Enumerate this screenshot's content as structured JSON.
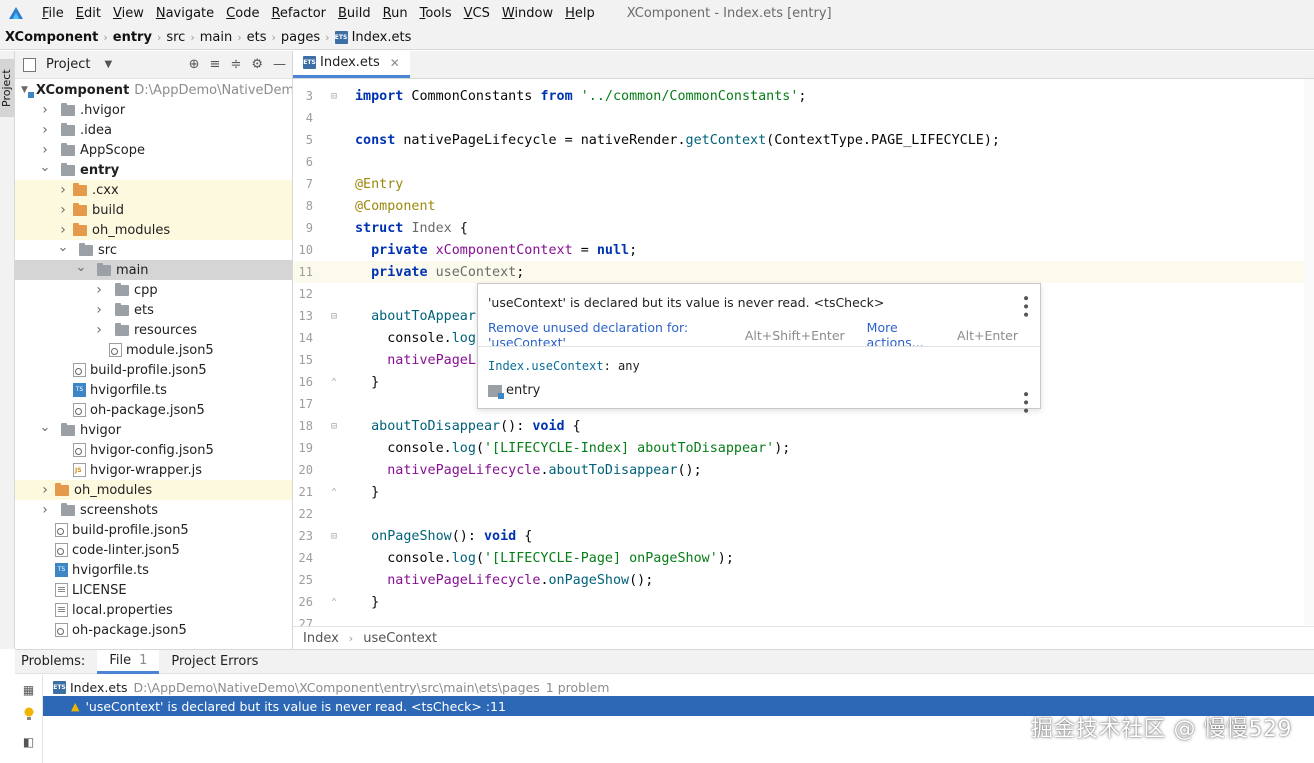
{
  "menubar": {
    "items": [
      "File",
      "Edit",
      "View",
      "Navigate",
      "Code",
      "Refactor",
      "Build",
      "Run",
      "Tools",
      "VCS",
      "Window",
      "Help"
    ],
    "window_title": "XComponent - Index.ets [entry]"
  },
  "breadcrumb": {
    "items": [
      "XComponent",
      "entry",
      "src",
      "main",
      "ets",
      "pages",
      "Index.ets"
    ]
  },
  "stripe": {
    "project_label": "Project"
  },
  "project_panel": {
    "title": "Project",
    "root": {
      "name": "XComponent",
      "path": "D:\\AppDemo\\NativeDemo"
    },
    "tree": [
      {
        "label": ".hvigor",
        "depth": 1,
        "icon": "folder",
        "color": "gray",
        "arrow": "right"
      },
      {
        "label": ".idea",
        "depth": 1,
        "icon": "folder",
        "color": "gray",
        "arrow": "right"
      },
      {
        "label": "AppScope",
        "depth": 1,
        "icon": "folder",
        "color": "gray",
        "arrow": "right"
      },
      {
        "label": "entry",
        "depth": 1,
        "icon": "folder",
        "color": "gray",
        "arrow": "down",
        "bold": true
      },
      {
        "label": ".cxx",
        "depth": 2,
        "icon": "folder",
        "color": "orange",
        "arrow": "right",
        "highlight": "yellow"
      },
      {
        "label": "build",
        "depth": 2,
        "icon": "folder",
        "color": "orange",
        "arrow": "right",
        "highlight": "yellow"
      },
      {
        "label": "oh_modules",
        "depth": 2,
        "icon": "folder",
        "color": "orange",
        "arrow": "right",
        "highlight": "yellow"
      },
      {
        "label": "src",
        "depth": 2,
        "icon": "folder",
        "color": "gray",
        "arrow": "down"
      },
      {
        "label": "main",
        "depth": 3,
        "icon": "folder",
        "color": "gray",
        "arrow": "down",
        "highlight": "gray"
      },
      {
        "label": "cpp",
        "depth": 4,
        "icon": "folder",
        "color": "gray",
        "arrow": "right"
      },
      {
        "label": "ets",
        "depth": 4,
        "icon": "folder",
        "color": "gray",
        "arrow": "right"
      },
      {
        "label": "resources",
        "depth": 4,
        "icon": "folder",
        "color": "gray",
        "arrow": "right"
      },
      {
        "label": "module.json5",
        "depth": 4,
        "icon": "json",
        "arrow": "none"
      },
      {
        "label": "build-profile.json5",
        "depth": 2,
        "icon": "json",
        "arrow": "none"
      },
      {
        "label": "hvigorfile.ts",
        "depth": 2,
        "icon": "ts",
        "arrow": "none"
      },
      {
        "label": "oh-package.json5",
        "depth": 2,
        "icon": "json",
        "arrow": "none"
      },
      {
        "label": "hvigor",
        "depth": 1,
        "icon": "folder",
        "color": "gray",
        "arrow": "down"
      },
      {
        "label": "hvigor-config.json5",
        "depth": 2,
        "icon": "json",
        "arrow": "none"
      },
      {
        "label": "hvigor-wrapper.js",
        "depth": 2,
        "icon": "js",
        "arrow": "none"
      },
      {
        "label": "oh_modules",
        "depth": 1,
        "icon": "folder",
        "color": "orange",
        "arrow": "right",
        "highlight": "yellow"
      },
      {
        "label": "screenshots",
        "depth": 1,
        "icon": "folder",
        "color": "gray",
        "arrow": "right"
      },
      {
        "label": "build-profile.json5",
        "depth": 1,
        "icon": "json",
        "arrow": "none"
      },
      {
        "label": "code-linter.json5",
        "depth": 1,
        "icon": "json",
        "arrow": "none"
      },
      {
        "label": "hvigorfile.ts",
        "depth": 1,
        "icon": "ts",
        "arrow": "none"
      },
      {
        "label": "LICENSE",
        "depth": 1,
        "icon": "text",
        "arrow": "none"
      },
      {
        "label": "local.properties",
        "depth": 1,
        "icon": "text",
        "arrow": "none"
      },
      {
        "label": "oh-package.json5",
        "depth": 1,
        "icon": "json",
        "arrow": "none"
      }
    ]
  },
  "editor": {
    "tab_label": "Index.ets",
    "footer": {
      "scope": "Index",
      "member": "useContext"
    },
    "lines": [
      {
        "n": "3",
        "fold": "start",
        "tokens": [
          [
            "kw",
            "import"
          ],
          [
            "code",
            " CommonConstants "
          ],
          [
            "kw",
            "from"
          ],
          [
            "code",
            " "
          ],
          [
            "str",
            "'../common/CommonConstants'"
          ],
          [
            "code",
            ";"
          ]
        ]
      },
      {
        "n": "4",
        "tokens": []
      },
      {
        "n": "5",
        "tokens": [
          [
            "kw",
            "const"
          ],
          [
            "code",
            " nativePageLifecycle = nativeRender."
          ],
          [
            "fn",
            "getContext"
          ],
          [
            "code",
            "(ContextType."
          ],
          [
            "code",
            "PAGE_LIFECYCLE"
          ],
          [
            "code",
            ");"
          ]
        ]
      },
      {
        "n": "6",
        "tokens": []
      },
      {
        "n": "7",
        "tokens": [
          [
            "dec",
            "@Entry"
          ]
        ]
      },
      {
        "n": "8",
        "tokens": [
          [
            "dec",
            "@Component"
          ]
        ]
      },
      {
        "n": "9",
        "tokens": [
          [
            "kw",
            "struct"
          ],
          [
            "code",
            " "
          ],
          [
            "muted",
            "Index"
          ],
          [
            "code",
            " {"
          ]
        ]
      },
      {
        "n": "10",
        "tokens": [
          [
            "code",
            "  "
          ],
          [
            "kw",
            "private"
          ],
          [
            "code",
            " "
          ],
          [
            "purple",
            "xComponentContext"
          ],
          [
            "code",
            " = "
          ],
          [
            "kw",
            "null"
          ],
          [
            "code",
            ";"
          ]
        ]
      },
      {
        "n": "11",
        "current": true,
        "tokens": [
          [
            "code",
            "  "
          ],
          [
            "kw",
            "private"
          ],
          [
            "code",
            " "
          ],
          [
            "muted",
            "useContext"
          ],
          [
            "code",
            ";"
          ]
        ]
      },
      {
        "n": "12",
        "tokens": []
      },
      {
        "n": "13",
        "fold": "start",
        "tokens": [
          [
            "code",
            "  "
          ],
          [
            "fn",
            "aboutToAppear"
          ]
        ]
      },
      {
        "n": "14",
        "tokens": [
          [
            "code",
            "    console."
          ],
          [
            "fn",
            "log"
          ]
        ]
      },
      {
        "n": "15",
        "tokens": [
          [
            "code",
            "    "
          ],
          [
            "purple",
            "nativePageL"
          ]
        ]
      },
      {
        "n": "16",
        "fold": "end",
        "tokens": [
          [
            "code",
            "  }"
          ]
        ]
      },
      {
        "n": "17",
        "tokens": []
      },
      {
        "n": "18",
        "fold": "start",
        "tokens": [
          [
            "code",
            "  "
          ],
          [
            "fn",
            "aboutToDisappear"
          ],
          [
            "code",
            "(): "
          ],
          [
            "kw",
            "void"
          ],
          [
            "code",
            " {"
          ]
        ]
      },
      {
        "n": "19",
        "tokens": [
          [
            "code",
            "    console."
          ],
          [
            "fn",
            "log"
          ],
          [
            "code",
            "("
          ],
          [
            "str",
            "'[LIFECYCLE-Index] aboutToDisappear'"
          ],
          [
            "code",
            ");"
          ]
        ]
      },
      {
        "n": "20",
        "tokens": [
          [
            "code",
            "    "
          ],
          [
            "purple",
            "nativePageLifecycle"
          ],
          [
            "code",
            "."
          ],
          [
            "fn",
            "aboutToDisappear"
          ],
          [
            "code",
            "();"
          ]
        ]
      },
      {
        "n": "21",
        "fold": "end",
        "tokens": [
          [
            "code",
            "  }"
          ]
        ]
      },
      {
        "n": "22",
        "tokens": []
      },
      {
        "n": "23",
        "fold": "start",
        "tokens": [
          [
            "code",
            "  "
          ],
          [
            "fn",
            "onPageShow"
          ],
          [
            "code",
            "(): "
          ],
          [
            "kw",
            "void"
          ],
          [
            "code",
            " {"
          ]
        ]
      },
      {
        "n": "24",
        "tokens": [
          [
            "code",
            "    console."
          ],
          [
            "fn",
            "log"
          ],
          [
            "code",
            "("
          ],
          [
            "str",
            "'[LIFECYCLE-Page] onPageShow'"
          ],
          [
            "code",
            ");"
          ]
        ]
      },
      {
        "n": "25",
        "tokens": [
          [
            "code",
            "    "
          ],
          [
            "purple",
            "nativePageLifecycle"
          ],
          [
            "code",
            "."
          ],
          [
            "fn",
            "onPageShow"
          ],
          [
            "code",
            "();"
          ]
        ]
      },
      {
        "n": "26",
        "fold": "end",
        "tokens": [
          [
            "code",
            "  }"
          ]
        ]
      },
      {
        "n": "27",
        "tokens": []
      }
    ]
  },
  "popup": {
    "message": "'useContext' is declared but its value is never read. <tsCheck>",
    "action_label": "Remove unused declaration for: 'useContext'",
    "action_shortcut": "Alt+Shift+Enter",
    "more_label": "More actions...",
    "more_shortcut": "Alt+Enter",
    "signature_name": "Index.useContext",
    "signature_type": ": any",
    "module": "entry"
  },
  "problems": {
    "label": "Problems:",
    "tabs": [
      {
        "label": "File",
        "count": "1"
      },
      {
        "label": "Project Errors"
      }
    ],
    "file_name": "Index.ets",
    "file_path": "D:\\AppDemo\\NativeDemo\\XComponent\\entry\\src\\main\\ets\\pages",
    "problem_count": "1 problem",
    "issue": "'useContext' is declared but its value is never read. <tsCheck> :11"
  },
  "watermark": "掘金技术社区 @ 慢慢529",
  "colors": {
    "accent": "#4a84d2",
    "selection": "#2d68b6",
    "keyword": "#0033b3",
    "string": "#067d17",
    "warning": "#f0b400"
  },
  "icons": [
    "app-logo-icon",
    "folder-icon",
    "ts-file-icon",
    "json-file-icon",
    "js-file-icon",
    "warning-icon",
    "lightbulb-icon",
    "kebab-menu-icon"
  ]
}
